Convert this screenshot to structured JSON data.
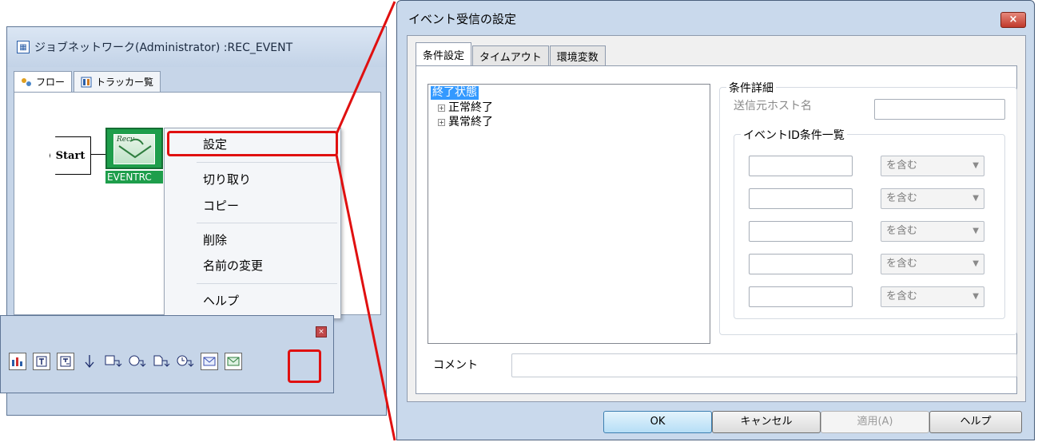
{
  "background_window": {
    "title": "ジョブネットワーク(Administrator) :REC_EVENT",
    "tabs": [
      {
        "label": "フロー"
      },
      {
        "label": "トラッカー覧"
      }
    ],
    "start_node": "Start",
    "event_node_label": "EVENTRC",
    "event_icon_text": "Recv"
  },
  "context_menu": {
    "items": [
      "設定",
      "切り取り",
      "コピー",
      "削除",
      "名前の変更",
      "ヘルプ"
    ],
    "highlighted": "設定"
  },
  "palette": {
    "close_symbol": "×",
    "tools": [
      "bar-chart-icon",
      "job-icon",
      "job-or-icon",
      "down-arrow-icon",
      "branch-icon",
      "event-branch-icon",
      "file-branch-icon",
      "time-branch-icon",
      "event-send-icon",
      "event-receive-icon"
    ],
    "highlighted_tool": "event-receive-icon"
  },
  "dialog": {
    "title": "イベント受信の設定",
    "close_symbol": "×",
    "tabs": [
      {
        "label": "条件設定",
        "active": true
      },
      {
        "label": "タイムアウト",
        "active": false
      },
      {
        "label": "環境変数",
        "active": false
      }
    ],
    "tree": {
      "root": "終了状態",
      "expander": "+",
      "children": [
        "正常終了",
        "異常終了"
      ]
    },
    "condition_detail": {
      "group_label": "条件詳細",
      "source_host_label": "送信元ホスト名",
      "source_host_value": "",
      "event_id_group_label": "イベントID条件一覧",
      "event_id_rows": [
        {
          "value": "",
          "match": "を含む"
        },
        {
          "value": "",
          "match": "を含む"
        },
        {
          "value": "",
          "match": "を含む"
        },
        {
          "value": "",
          "match": "を含む"
        },
        {
          "value": "",
          "match": "を含む"
        }
      ],
      "dropdown_arrow": "▼"
    },
    "comment_label": "コメント",
    "comment_value": "",
    "buttons": {
      "ok": "OK",
      "cancel": "キャンセル",
      "apply": "適用(A)",
      "help": "ヘルプ"
    }
  },
  "colors": {
    "highlight": "#e01010",
    "selection": "#3399ff",
    "event_node": "#1e9e4b"
  }
}
